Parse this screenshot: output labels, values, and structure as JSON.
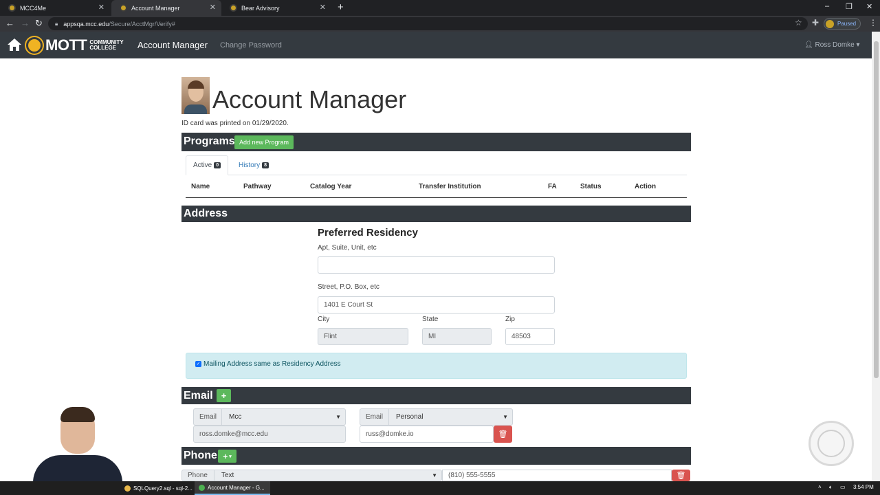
{
  "browser": {
    "tabs": [
      {
        "label": "MCC4Me"
      },
      {
        "label": "Account Manager"
      },
      {
        "label": "Bear Advisory"
      }
    ],
    "url_host": "appsqa.mcc.edu",
    "url_path": "/Secure/AcctMgr/Verify#",
    "profile_status": "Paused"
  },
  "navbar": {
    "logo_mott": "MOTT",
    "logo_cc_1": "COMMUNITY",
    "logo_cc_2": "COLLEGE",
    "title": "Account Manager",
    "change_password": "Change Password",
    "user": "Ross Domke"
  },
  "page": {
    "title": "Account Manager",
    "id_note": "ID card was printed on 01/29/2020."
  },
  "programs": {
    "heading": "Programs",
    "add_button": "Add new Program",
    "tabs": [
      {
        "label": "Active",
        "count": "0"
      },
      {
        "label": "History",
        "count": "8"
      }
    ],
    "columns": [
      "Name",
      "Pathway",
      "Catalog Year",
      "Transfer Institution",
      "FA",
      "Status",
      "Action"
    ]
  },
  "address": {
    "heading": "Address",
    "subheading": "Preferred Residency",
    "apt_label": "Apt, Suite, Unit, etc",
    "apt_value": "",
    "street_label": "Street, P.O. Box, etc",
    "street_value": "1401 E Court St",
    "city_label": "City",
    "city_value": "Flint",
    "state_label": "State",
    "state_value": "MI",
    "zip_label": "Zip",
    "zip_value": "48503",
    "mailing_same_label": "Mailing Address same as Residency Address"
  },
  "email": {
    "heading": "Email",
    "add_icon": "+",
    "entries": [
      {
        "prefix": "Email",
        "type": "Mcc",
        "address": "ross.domke@mcc.edu"
      },
      {
        "prefix": "Email",
        "type": "Personal",
        "address": "russ@domke.io"
      }
    ]
  },
  "phone": {
    "heading": "Phone",
    "add_icon": "+",
    "entries": [
      {
        "prefix": "Phone",
        "type": "Text",
        "number": "(810) 555-5555"
      }
    ]
  },
  "taskbar": {
    "items": [
      {
        "label": "SQLQuery2.sql - sql-2..."
      },
      {
        "label": "Account Manager - G..."
      }
    ],
    "clock": "3:54 PM"
  },
  "colors": {
    "navbar": "#343a40",
    "success": "#5cb85c",
    "danger": "#d9534f",
    "info_bg": "#d1ecf1"
  }
}
